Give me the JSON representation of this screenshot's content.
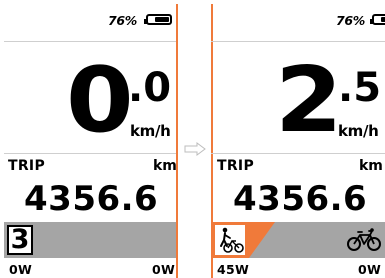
{
  "left_screen": {
    "battery_percent": "76%",
    "battery_level": 0.7,
    "speed_integer": "0",
    "speed_decimal": ".0",
    "speed_unit": "km/h",
    "trip_label": "TRIP",
    "trip_unit": "km",
    "trip_value": "4356.6",
    "assist_level": "3",
    "power_left": "0W",
    "power_right": "0W"
  },
  "right_screen": {
    "battery_percent": "76%",
    "battery_level": 0.7,
    "speed_integer": "2",
    "speed_decimal": ".5",
    "speed_unit": "km/h",
    "trip_label": "TRIP",
    "trip_unit": "km",
    "trip_value": "4356.6",
    "walk_icon": "walking-with-bike-icon",
    "bike_icon": "bicycle-icon",
    "power_left": "45W",
    "power_right": "0W"
  },
  "colors": {
    "accent_orange": "#f07a3a",
    "assist_bar_gray": "#a5a5a5",
    "separator_gray": "#cfcfcf",
    "arrow_gray": "#bdbdbd"
  }
}
